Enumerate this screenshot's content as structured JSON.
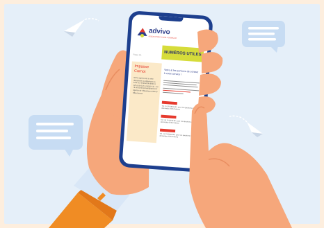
{
  "site": {
    "brand": "advivo",
    "tagline": "ASSOCIATION D'AIDE A DOMICILE",
    "breadcrumb": "Page 1/1"
  },
  "page": {
    "title": "NUMÉROS UTILES"
  },
  "sidebar": {
    "title": "Impasse Carnot",
    "text": "Notre agence est à votre disposition au téléphone du lundi au vendredi de 8h30 à 12h et de 13h à 16h30 Tél. : 04 78 38 59 88 accueil@advivo.fr Agence de Villeurbanne 69100 Villeurbanne"
  },
  "main": {
    "heading": "Votre & les services de contact à votre service !",
    "sections": [
      {
        "text": "Tél : 04 78 38 59 88 - pour vos questions et vos demandes d'informations"
      },
      {
        "text": "Tél : 04 78 38 59 88 - pour vos questions et vos demandes d'informations"
      },
      {
        "text": "Tél : 04 78 38 59 88 - pour vos questions et vos demandes d'informations"
      }
    ]
  },
  "colors": {
    "background": "#fdeede",
    "panel": "#e5eff9",
    "phone": "#1d3f8e",
    "accent_red": "#e63a2e",
    "accent_lime": "#d6dc3a",
    "brand_blue": "#2f3f8a",
    "skin": "#f6a77b",
    "sleeve": "#d9e7f7",
    "jacket": "#f08c24"
  }
}
